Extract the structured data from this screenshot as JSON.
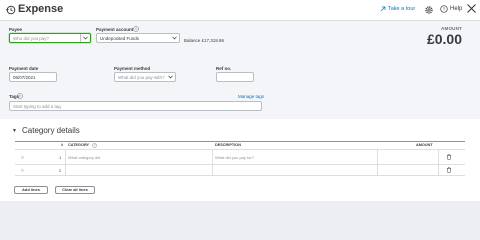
{
  "header": {
    "title": "Expense",
    "take_tour": "Take a tour",
    "help": "Help"
  },
  "form": {
    "payee": {
      "label": "Payee",
      "placeholder": "Who did you pay?"
    },
    "payment_account": {
      "label": "Payment account",
      "value": "Undeposited Funds"
    },
    "balance": "Balance £17,319.86",
    "amount_label": "AMOUNT",
    "amount_value": "£0.00",
    "payment_date": {
      "label": "Payment date",
      "value": "06/07/2021"
    },
    "payment_method": {
      "label": "Payment method",
      "placeholder": "What did you pay with?"
    },
    "ref_no": {
      "label": "Ref no."
    },
    "tags": {
      "label": "Tags",
      "placeholder": "Start typing to add a tag",
      "manage": "Manage tags"
    }
  },
  "category_details": {
    "title": "Category details",
    "columns": [
      "#",
      "CATEGORY",
      "DESCRIPTION",
      "AMOUNT"
    ],
    "rows": [
      {
        "num": "1",
        "category_placeholder": "What category did",
        "description_placeholder": "What did you pay for?"
      },
      {
        "num": "2",
        "category_placeholder": "",
        "description_placeholder": ""
      }
    ],
    "add_lines": "Add lines",
    "clear_lines": "Clear all lines"
  },
  "colors": {
    "accent_green": "#2ca01c",
    "link_blue": "#0077c5"
  }
}
